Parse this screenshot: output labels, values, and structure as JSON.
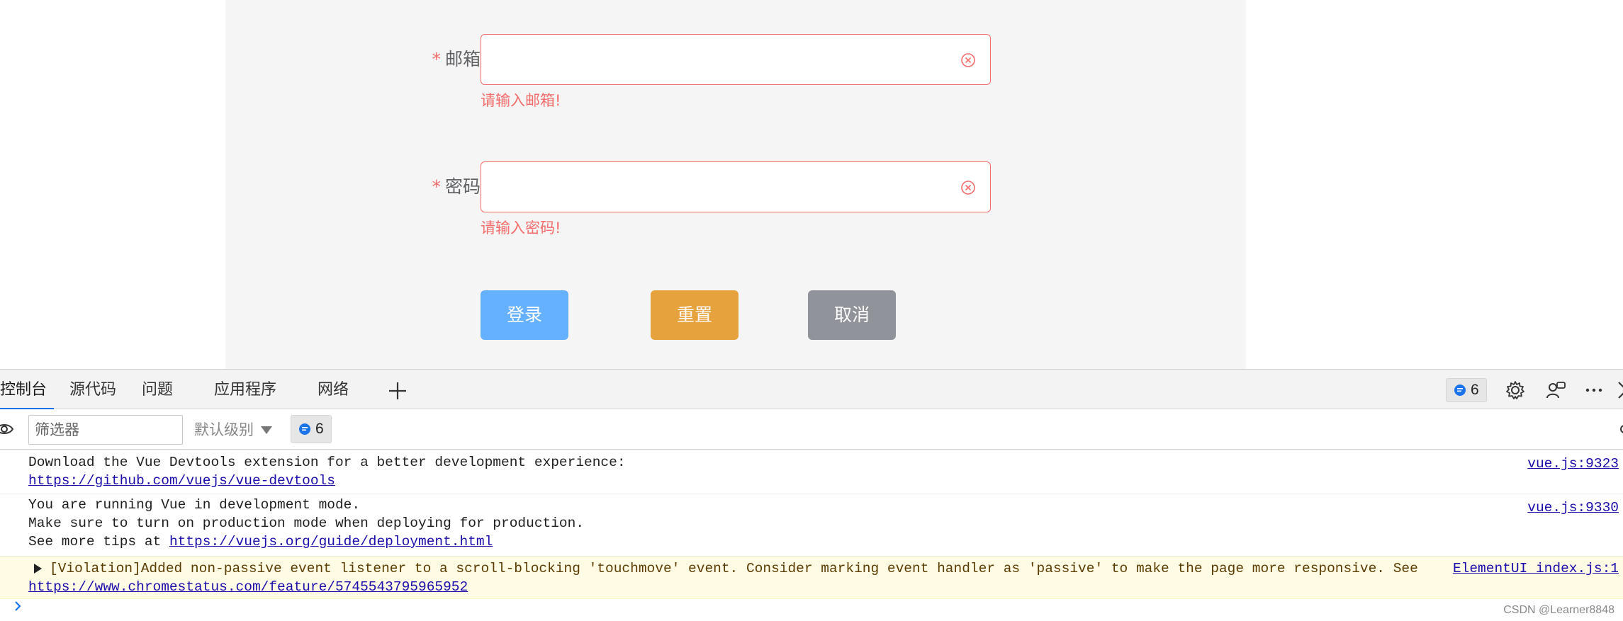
{
  "form": {
    "email": {
      "required_mark": "*",
      "label": "邮箱",
      "value": "",
      "error": "请输入邮箱!"
    },
    "password": {
      "required_mark": "*",
      "label": "密码",
      "value": "",
      "error": "请输入密码!"
    },
    "buttons": {
      "login": "登录",
      "reset": "重置",
      "cancel": "取消"
    }
  },
  "devtools": {
    "tabs": [
      "控制台",
      "源代码",
      "问题",
      "应用程序",
      "网络"
    ],
    "message_count": "6",
    "filter_placeholder": "筛选器",
    "level_label": "默认级别",
    "logs": [
      {
        "lines": [
          "Download the Vue Devtools extension for a better development experience:"
        ],
        "link": "https://github.com/vuejs/vue-devtools",
        "source": "vue.js:9323"
      },
      {
        "lines": [
          "You are running Vue in development mode.",
          "Make sure to turn on production mode when deploying for production."
        ],
        "prefix": "See more tips at ",
        "link": "https://vuejs.org/guide/deployment.html",
        "source": "vue.js:9330"
      },
      {
        "text": "[Violation]Added non-passive event listener to a scroll-blocking 'touchmove' event. Consider marking event handler as 'passive' to make the page more responsive. See",
        "link": "https://www.chromestatus.com/feature/5745543795965952",
        "source": "ElementUI index.js:1"
      }
    ]
  },
  "watermark": "CSDN @Learner8848",
  "colors": {
    "error": "#f56c6c",
    "login": "#66b1ff",
    "reset": "#e6a23c",
    "cancel": "#909399",
    "link": "#1a0dab"
  }
}
